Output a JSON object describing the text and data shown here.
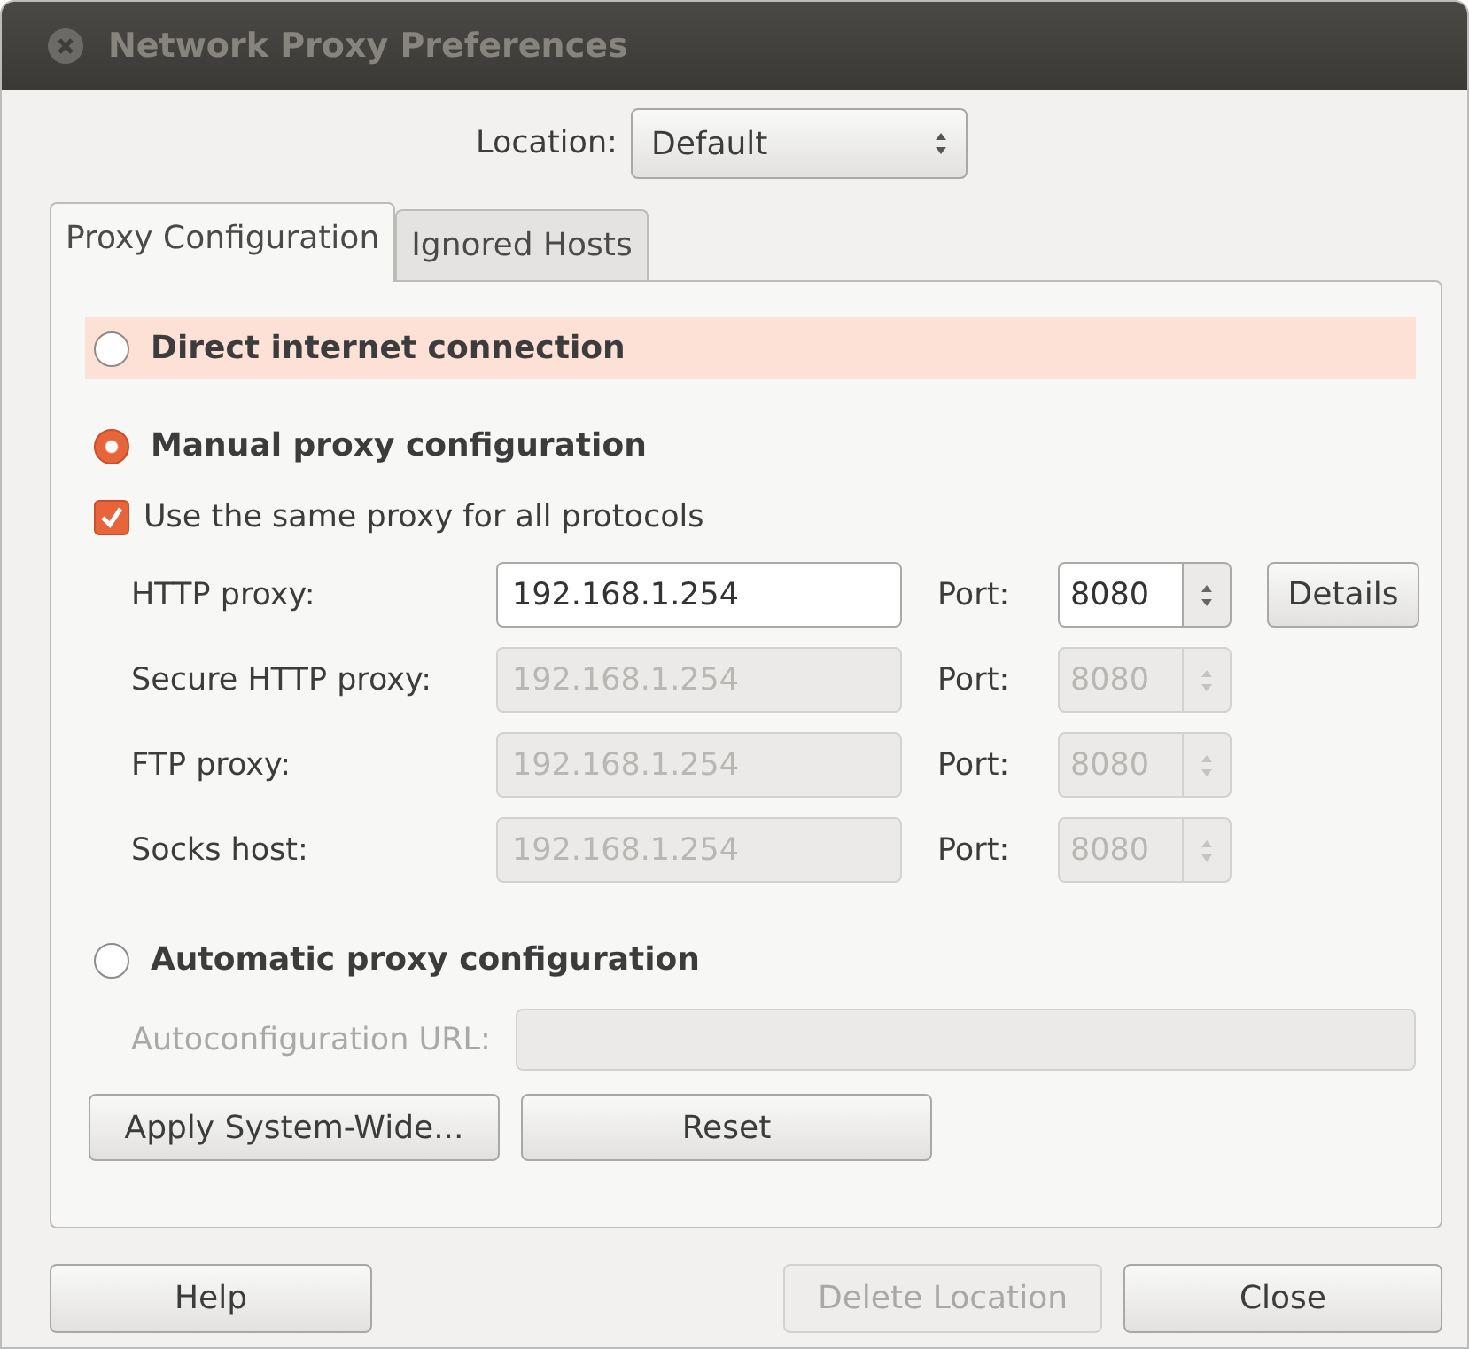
{
  "window": {
    "title": "Network Proxy Preferences"
  },
  "location": {
    "label": "Location:",
    "value": "Default"
  },
  "tabs": [
    {
      "label": "Proxy Configuration",
      "selected": true
    },
    {
      "label": "Ignored Hosts",
      "selected": false
    }
  ],
  "direct": {
    "label": "Direct internet connection",
    "selected": false,
    "highlighted": true
  },
  "manual": {
    "label": "Manual proxy configuration",
    "selected": true,
    "same_proxy": {
      "label": "Use the same proxy for all protocols",
      "checked": true
    },
    "proxies": [
      {
        "label": "HTTP proxy:",
        "value": "192.168.1.254",
        "port_label": "Port:",
        "port": "8080",
        "disabled": false,
        "details_button": "Details"
      },
      {
        "label": "Secure HTTP proxy:",
        "value": "192.168.1.254",
        "port_label": "Port:",
        "port": "8080",
        "disabled": true
      },
      {
        "label": "FTP proxy:",
        "value": "192.168.1.254",
        "port_label": "Port:",
        "port": "8080",
        "disabled": true
      },
      {
        "label": "Socks host:",
        "value": "192.168.1.254",
        "port_label": "Port:",
        "port": "8080",
        "disabled": true
      }
    ]
  },
  "automatic": {
    "label": "Automatic proxy configuration",
    "selected": false,
    "url": {
      "label": "Autoconfiguration URL:",
      "disabled": true
    }
  },
  "action_buttons": [
    {
      "label": "Apply System-Wide..."
    },
    {
      "label": "Reset"
    }
  ],
  "footer": {
    "left": [
      {
        "label": "Help",
        "disabled": false
      }
    ],
    "right": [
      {
        "label": "Delete Location",
        "disabled": true
      },
      {
        "label": "Close",
        "disabled": false
      }
    ]
  }
}
